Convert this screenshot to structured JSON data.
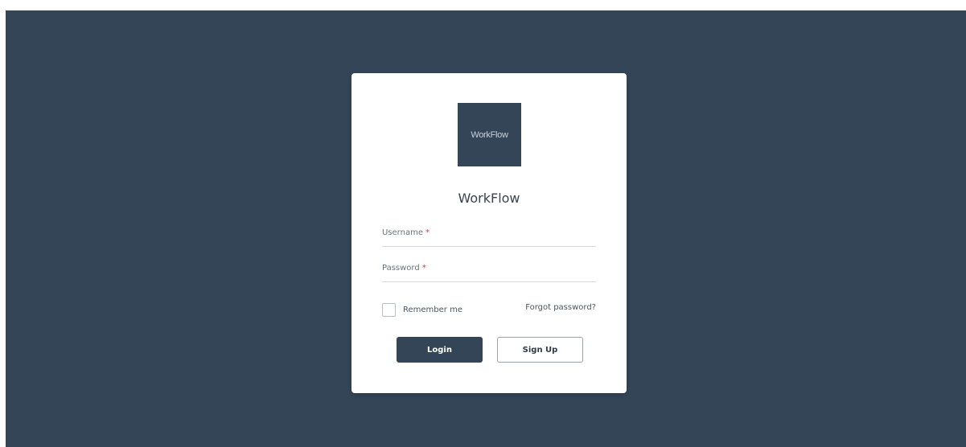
{
  "app": {
    "logo_text": "WorkFlow",
    "title": "WorkFlow"
  },
  "form": {
    "username_label": "Username",
    "password_label": "Password",
    "required_marker": "*",
    "username_value": "",
    "password_value": "",
    "remember_label": "Remember me",
    "remember_checked": false,
    "forgot_label": "Forgot password?"
  },
  "actions": {
    "login_label": "Login",
    "signup_label": "Sign Up"
  },
  "colors": {
    "brand": "#344557",
    "required": "#d93b3b"
  }
}
